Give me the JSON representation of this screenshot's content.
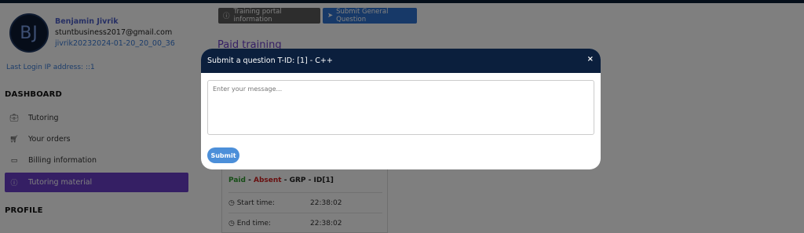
{
  "user": {
    "initials": "BJ",
    "name": "Benjamin Jivrik",
    "email": "stuntbusiness2017@gmail.com",
    "id": "jivrik20232024-01-20_20_00_36",
    "last_login": "Last Login IP address: ::1"
  },
  "sidebar": {
    "dashboard_title": "DASHBOARD",
    "items": [
      {
        "label": "Tutoring",
        "icon": "briefcase-icon"
      },
      {
        "label": "Your orders",
        "icon": "cart-icon"
      },
      {
        "label": "Billing information",
        "icon": "credit-card-icon"
      },
      {
        "label": "Tutoring material",
        "icon": "info-icon",
        "active": true
      }
    ],
    "profile_title": "PROFILE"
  },
  "toolbar": {
    "training_label": "Training portal information",
    "submit_question_label": "Submit General Question"
  },
  "main": {
    "paid_title": "Paid training",
    "card": {
      "status_paid": "Paid",
      "status_absent": "Absent",
      "group": "GRP",
      "id": "ID[1]",
      "start_label": "Start time:",
      "start_value": "22:38:02",
      "end_label": "End time:",
      "end_value": "22:38:02"
    }
  },
  "modal": {
    "title": "Submit a question T-ID: [1] - C++",
    "placeholder": "Enter your message...",
    "submit_label": "Submit",
    "close_label": "×"
  },
  "colors": {
    "accent_purple": "#6a3fc8",
    "modal_header": "#0b1f3d",
    "primary_blue": "#2f73d0"
  }
}
